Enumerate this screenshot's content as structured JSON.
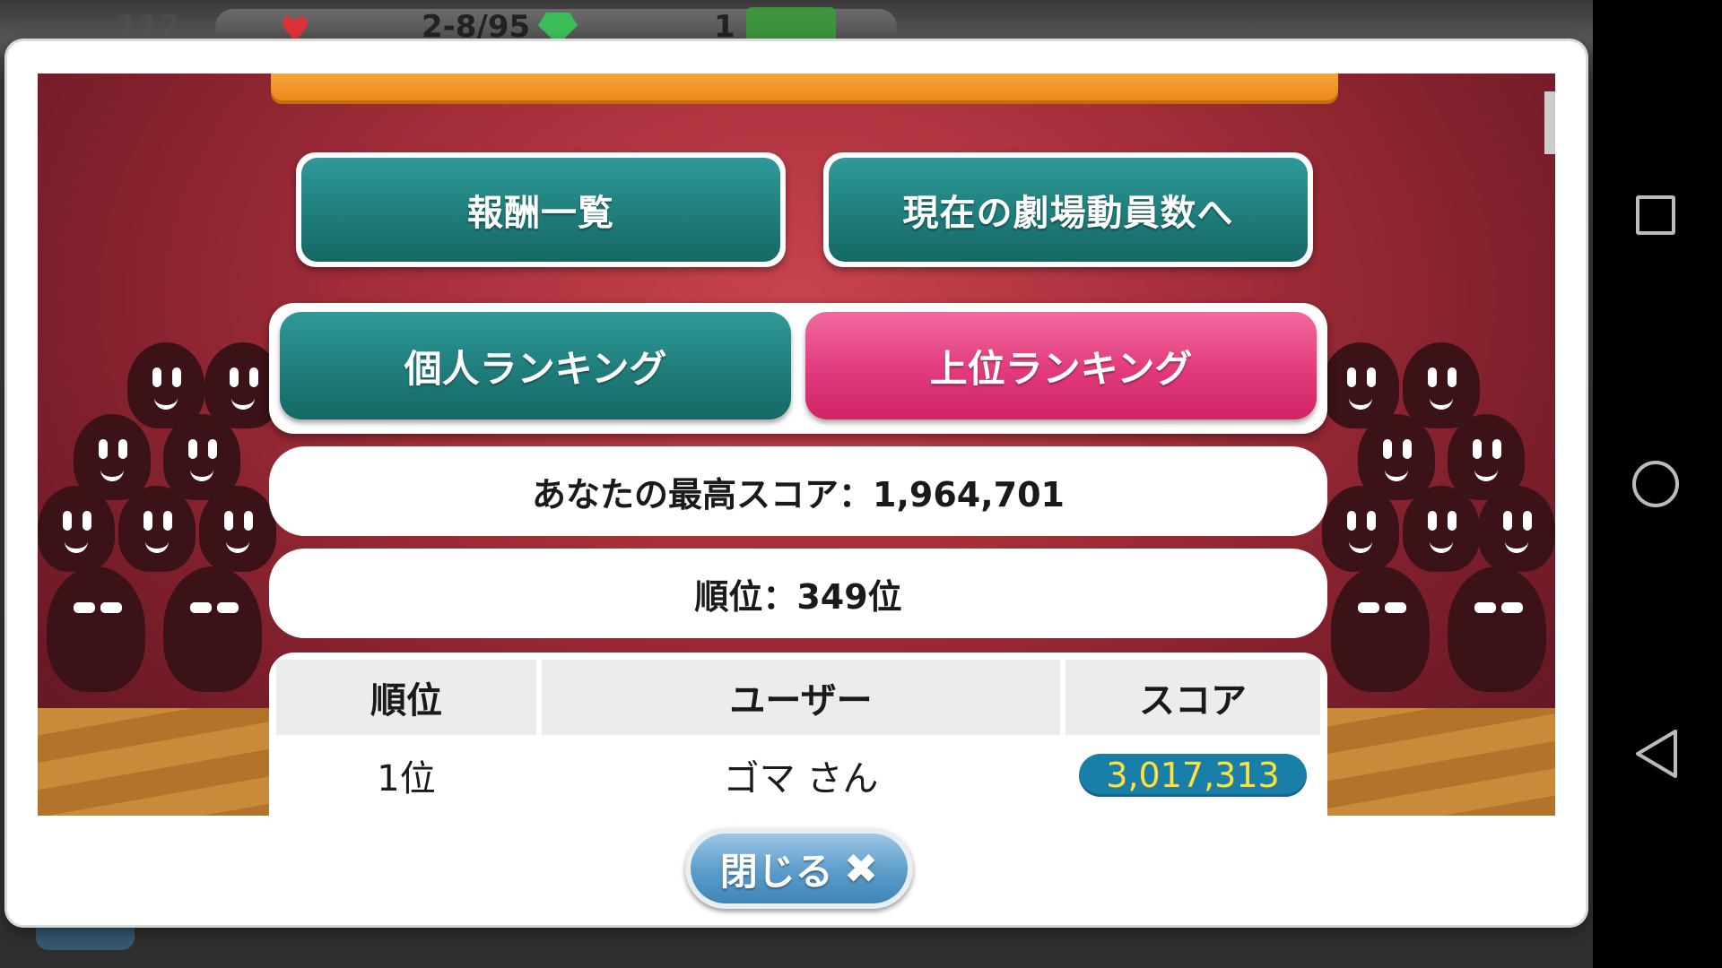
{
  "hud": {
    "level": "112",
    "stamina": "2-8/95",
    "count": "1"
  },
  "modal": {
    "buttons": {
      "rewards_list": "報酬一覧",
      "theater_attendance": "現在の劇場動員数へ"
    },
    "tabs": {
      "personal_ranking": "個人ランキング",
      "top_ranking": "上位ランキング"
    },
    "best_score": "あなたの最高スコア：1,964,701",
    "rank": "順位：349位",
    "table": {
      "headers": [
        "順位",
        "ユーザー",
        "スコア"
      ],
      "rows": [
        {
          "rank": "1位",
          "user": "ゴマ さん",
          "score": "3,017,313"
        }
      ]
    },
    "close_label": "閉じる",
    "close_icon": "✖"
  },
  "colors": {
    "teal": "#1f7d7b",
    "pink": "#e23a7c",
    "orange": "#ec8a1a",
    "score_badge": "#1a7fa8",
    "score_text": "#ffe13a"
  }
}
